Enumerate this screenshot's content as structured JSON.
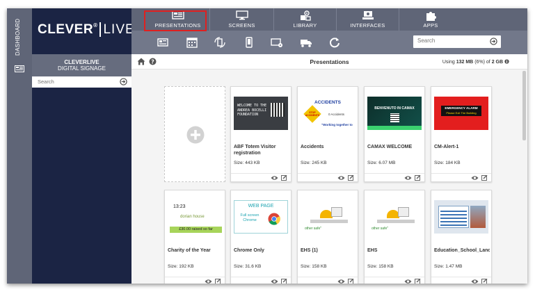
{
  "sidebar_dashboard": {
    "label": "DASHBOARD"
  },
  "logo": {
    "brand": "CLEVER",
    "registered": "®",
    "suffix": "LIVE"
  },
  "topnav": {
    "tabs": [
      {
        "label": "PRESENTATIONS",
        "icon": "presentation-icon",
        "active": true
      },
      {
        "label": "SCREENS",
        "icon": "monitor-icon"
      },
      {
        "label": "LIBRARY",
        "icon": "library-icon"
      },
      {
        "label": "INTERFACES",
        "icon": "interfaces-icon"
      },
      {
        "label": "APPS",
        "icon": "puzzle-icon"
      }
    ],
    "highlight_color": "#e02020"
  },
  "toolbar": {
    "icons": [
      "slides-icon",
      "calendar-icon",
      "rotate-icon",
      "mobile-icon",
      "screen-settings-icon",
      "truck-icon",
      "refresh-icon"
    ],
    "search_placeholder": "Search"
  },
  "side_panel": {
    "title": "CLEVERLIVE",
    "subtitle": "DIGITAL SIGNAGE",
    "search_placeholder": "Search"
  },
  "main": {
    "title": "Presentations",
    "usage_prefix": "Using",
    "usage_amount": "132 MB",
    "usage_mid": "(6%) of",
    "usage_total": "2 GB",
    "cards": [
      {
        "title": "ABF Totem Visitor registration",
        "size": "Size: 443 KB",
        "thumb_text": "WELCOME TO THE ANDREA BOCELLI FOUNDATION"
      },
      {
        "title": "Accidents",
        "size": "Size: 245 KB",
        "thumb_heading": "ACCIDENTS",
        "thumb_sign": "STOP ACCIDENTS",
        "thumb_side": "0 Accidents",
        "thumb_quote": "\"Working together to"
      },
      {
        "title": "CAMAX WELCOME",
        "size": "Size: 6.07 MB",
        "thumb_text": "BENVENUTO IN CAMAX"
      },
      {
        "title": "CM-Alert-1",
        "size": "Size: 184 KB",
        "thumb_line1": "EMERGENCY ALARM",
        "thumb_line2": "Please Exit The Building"
      },
      {
        "title": "Charity of the Year",
        "size": "Size: 192 KB",
        "thumb_time": "13:23",
        "thumb_brand": "dorian house",
        "thumb_raised": "£30.00 raised so far"
      },
      {
        "title": "Chrome Only",
        "size": "Size: 31.6 KB",
        "thumb_heading": "WEB PAGE",
        "thumb_sub": "Full screen Chrome"
      },
      {
        "title": "EHS (1)",
        "size": "Size: 158 KB",
        "thumb_caption": "other safe\""
      },
      {
        "title": "EHS",
        "size": "Size: 158 KB",
        "thumb_caption": "other safe\""
      },
      {
        "title": "Education_School_Landsca",
        "size": "Size: 1.47 MB"
      }
    ]
  }
}
